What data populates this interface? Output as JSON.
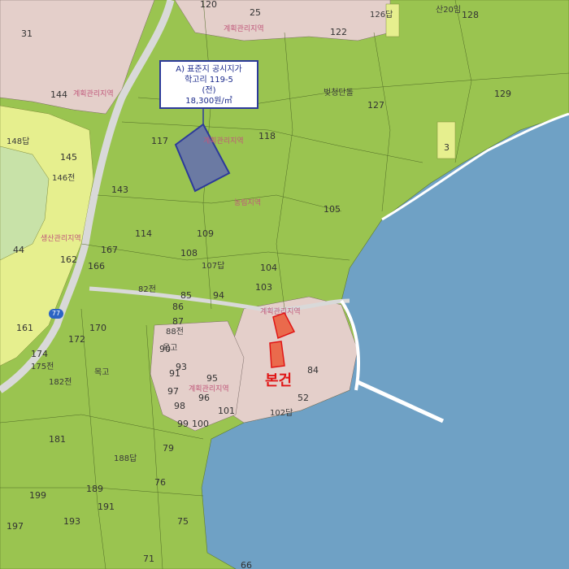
{
  "callout": {
    "line1": "A) 표준지 공시지가",
    "line2": "학고리 119-5",
    "line3": "(전)",
    "line4": "18,300원/㎡"
  },
  "subject_label": "본건",
  "route_badge": "77",
  "zone_labels": [
    "계획관리지역",
    "계획관리지역",
    "계획관리지역",
    "생산관리지역",
    "계획관리지역",
    "농림지역",
    "계획관리지역"
  ],
  "parcel_labels": [
    "120",
    "25",
    "126답",
    "산20임",
    "128",
    "122",
    "31",
    "44",
    "144",
    "145",
    "146전",
    "148답",
    "143",
    "117",
    "118",
    "127",
    "129",
    "105",
    "109",
    "108",
    "107답",
    "104",
    "103",
    "114",
    "167",
    "166",
    "162",
    "161",
    "170",
    "172",
    "174",
    "175전",
    "182전",
    "181",
    "199",
    "197",
    "193",
    "191",
    "189",
    "188답",
    "79",
    "76",
    "75",
    "71",
    "66",
    "94",
    "95",
    "96",
    "100",
    "101",
    "102답",
    "52",
    "84",
    "85",
    "86",
    "87",
    "88전",
    "90",
    "91",
    "93",
    "97",
    "98",
    "99",
    "82전",
    "3",
    "옥고",
    "벚청단돌",
    "목고"
  ],
  "colors": {
    "water": "#6fa1c5",
    "forest": "#9ac450",
    "residential": "#e4cfca",
    "farmland": "#e6ef8e",
    "road": "#d9d9d9",
    "standard_parcel": "#6b7aa3",
    "subject_parcel": "#ea6a4c",
    "callout_border": "#2c3a9a",
    "subject_text": "#e01515"
  }
}
